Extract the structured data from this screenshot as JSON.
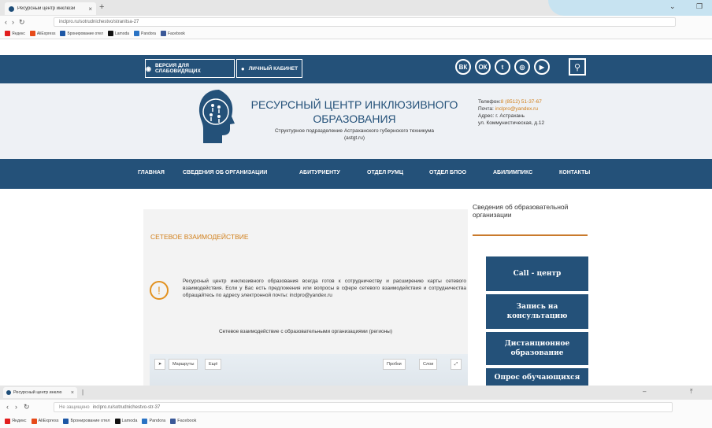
{
  "browser": {
    "tab_title": "Ресурсный центр инклюзи",
    "tab_close": "×",
    "new_tab": "+",
    "url": "inclpro.ru/sotrudnichestvo/stranitsa-27",
    "back": "‹",
    "forward": "›",
    "reload": "↻",
    "minimize": "⌄",
    "maximize": "❐",
    "bookmarks": [
      {
        "label": "Яндекс",
        "color": "#e21d1d"
      },
      {
        "label": "AliExpress",
        "color": "#e64a19"
      },
      {
        "label": "Бронирование отел",
        "color": "#1d57a5"
      },
      {
        "label": "Lamoda",
        "color": "#111111"
      },
      {
        "label": "Pandora",
        "color": "#2a73c4"
      },
      {
        "label": "Facebook",
        "color": "#3b5998"
      }
    ]
  },
  "browser2": {
    "tab_title": "Ресурсный центр инклю",
    "tab_close": "×",
    "new_tab": "|",
    "url": "inclpro.ru/sotrudnichestvo-str-37",
    "secure_label": "Не защищено",
    "bookmarks": [
      "Яндекс",
      "AliExpress",
      "Бронирование отел",
      "Lamoda",
      "Pandora",
      "Facebook"
    ]
  },
  "top": {
    "visually_impaired": "ВЕРСИЯ ДЛЯ СЛАБОВИДЯЩИХ",
    "cabinet": "ЛИЧНЫЙ КАБИНЕТ",
    "social_icons": [
      "vk-icon",
      "odnoklassniki-icon",
      "twitter-icon",
      "instagram-icon",
      "youtube-icon"
    ],
    "social_glyphs": [
      "ВК",
      "ОК",
      "t",
      "◎",
      "▶"
    ]
  },
  "header": {
    "title_line1": "РЕСУРСНЫЙ ЦЕНТР ИНКЛЮЗИВНОГО",
    "title_line2": "ОБРАЗОВАНИЯ",
    "subtitle_line1": "Структурное подразделение Астраханского губернского техникума",
    "subtitle_line2": "(astgt.ru)",
    "phone_label": "Телефон:",
    "phone": "8 (8512) 51-37-67",
    "email_label": "Почта:",
    "email": "inclpro@yandex.ru",
    "address_label": "Адрес:",
    "address_city": "г. Астрахань",
    "address_street": "ул. Коммунистическая, д.12"
  },
  "nav": [
    "ГЛАВНАЯ",
    "СВЕДЕНИЯ ОБ ОРГАНИЗАЦИИ",
    "АБИТУРИЕНТУ",
    "ОТДЕЛ РУМЦ",
    "ОТДЕЛ БПОО",
    "АБИЛИМПИКС",
    "КОНТАКТЫ"
  ],
  "main": {
    "section_title": "СЕТЕВОЕ ВЗАИМОДЕЙСТВИЕ",
    "alert": "Ресурсный центр инклюзивного образования всегда готов к сотрудничеству и расширению карты сетевого взаимодействия. Если у Вас есть предложения или вопросы в сфере сетевого взаимодействия и сотрудничества обращайтесь по адресу электронной почты: inclpro@yandex.ru",
    "map_title": "Сетевое взаимодействие с образовательными организациями (регионы)",
    "map_route": "Маршруты",
    "map_traffic": "Пробки",
    "map_layers": "Слои",
    "map_more": "Ещё"
  },
  "sidebar": {
    "heading": "Сведения об образовательной организации",
    "buttons": [
      "Call - центр",
      "Запись на консультацию",
      "Дистанционное образование",
      "Опрос обучающихся"
    ]
  },
  "colors": {
    "primary": "#245179",
    "accent": "#d17f1a"
  }
}
